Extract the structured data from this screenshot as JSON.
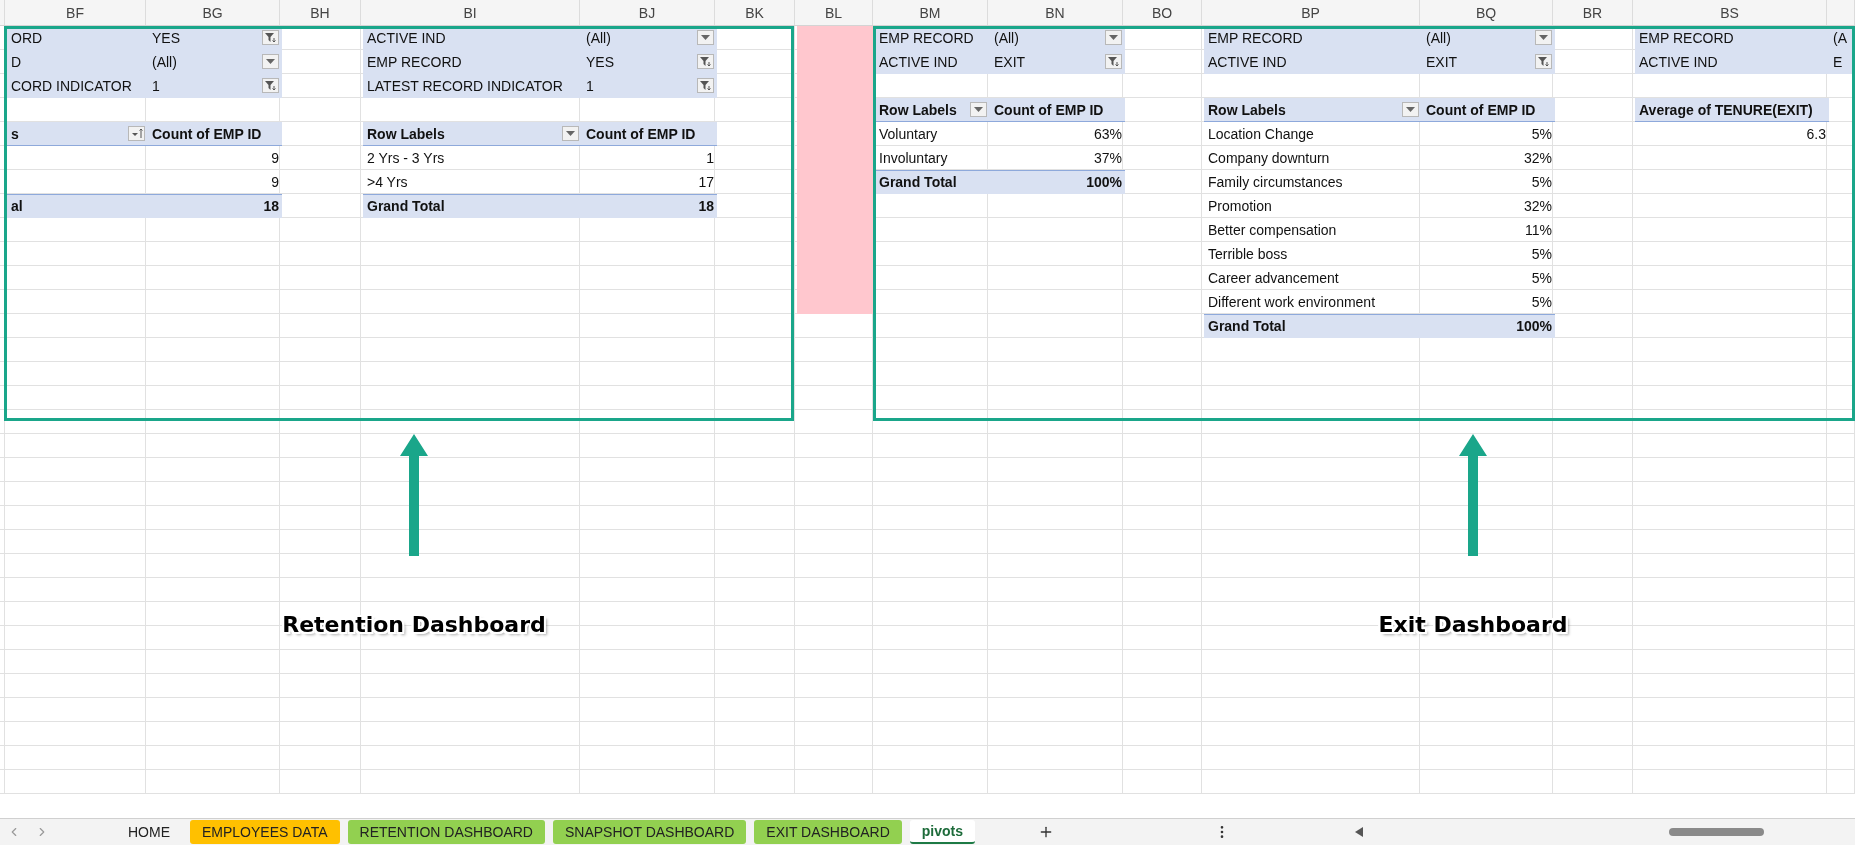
{
  "column_headers": [
    "BF",
    "BG",
    "BH",
    "BI",
    "BJ",
    "BK",
    "BL",
    "BM",
    "BN",
    "BO",
    "BP",
    "BQ",
    "BR",
    "BS"
  ],
  "pivots": [
    {
      "filters": [
        {
          "field": "ORD",
          "value": "YES",
          "filtered": true
        },
        {
          "field": "D",
          "value": "(All)",
          "filtered": false
        },
        {
          "field": "CORD INDICATOR",
          "value": "1",
          "filtered": true
        }
      ],
      "table": {
        "label_header": {
          "text": "s",
          "sorted": true
        },
        "value_header": "Count of EMP ID",
        "rows": [
          {
            "value": "9"
          },
          {
            "value": "9"
          }
        ],
        "total": {
          "label": "al",
          "value": "18"
        }
      }
    },
    {
      "filters": [
        {
          "field": "ACTIVE IND",
          "value": "(All)",
          "filtered": false
        },
        {
          "field": "EMP RECORD",
          "value": "YES",
          "filtered": true
        },
        {
          "field": "LATEST RECORD INDICATOR",
          "value": "1",
          "filtered": true
        }
      ],
      "table": {
        "label_header": {
          "text": "Row Labels",
          "sorted": false
        },
        "value_header": "Count of EMP ID",
        "rows": [
          {
            "label": "2 Yrs - 3 Yrs",
            "value": "1"
          },
          {
            "label": ">4 Yrs",
            "value": "17"
          }
        ],
        "total": {
          "label": "Grand Total",
          "value": "18"
        }
      }
    },
    {
      "filters": [
        {
          "field": "EMP RECORD",
          "value": "(All)",
          "filtered": false
        },
        {
          "field": "ACTIVE IND",
          "value": "EXIT",
          "filtered": true
        }
      ],
      "table": {
        "label_header": {
          "text": "Row Labels",
          "sorted": false
        },
        "value_header": "Count of EMP ID",
        "rows": [
          {
            "label": "Voluntary",
            "value": "63%"
          },
          {
            "label": "Involuntary",
            "value": "37%"
          }
        ],
        "total": {
          "label": "Grand Total",
          "value": "100%"
        }
      }
    },
    {
      "filters": [
        {
          "field": "EMP RECORD",
          "value": "(All)",
          "filtered": false
        },
        {
          "field": "ACTIVE IND",
          "value": "EXIT",
          "filtered": true
        }
      ],
      "table": {
        "label_header": {
          "text": "Row Labels",
          "sorted": false
        },
        "value_header": "Count of EMP ID",
        "rows": [
          {
            "label": "Location Change",
            "value": "5%"
          },
          {
            "label": "Company downturn",
            "value": "32%"
          },
          {
            "label": "Family circumstances",
            "value": "5%"
          },
          {
            "label": "Promotion",
            "value": "32%"
          },
          {
            "label": "Better compensation",
            "value": "11%"
          },
          {
            "label": "Terrible boss",
            "value": "5%"
          },
          {
            "label": "Career advancement",
            "value": "5%"
          },
          {
            "label": "Different work environment",
            "value": "5%"
          }
        ],
        "total": {
          "label": "Grand Total",
          "value": "100%"
        }
      }
    },
    {
      "filters": [
        {
          "field": "EMP RECORD",
          "value": "(A"
        },
        {
          "field": "ACTIVE IND",
          "value": "E"
        }
      ],
      "table": {
        "value_header": "Average of TENURE(EXIT)",
        "rows": [
          {
            "value": "6.3"
          }
        ]
      }
    }
  ],
  "annotations": [
    {
      "label": "Retention Dashboard"
    },
    {
      "label": "Exit Dashboard"
    }
  ],
  "sheet_tabs": [
    {
      "label": "HOME",
      "selected": false
    },
    {
      "label": "EMPLOYEES DATA",
      "color": "#ffc000",
      "selected": false
    },
    {
      "label": "RETENTION DASHBOARD",
      "color": "#92d050",
      "selected": false
    },
    {
      "label": "SNAPSHOT DASHBOARD",
      "color": "#92d050",
      "selected": false
    },
    {
      "label": "EXIT DASHBOARD",
      "color": "#92d050",
      "selected": false
    },
    {
      "label": "pivots",
      "selected": true
    }
  ]
}
